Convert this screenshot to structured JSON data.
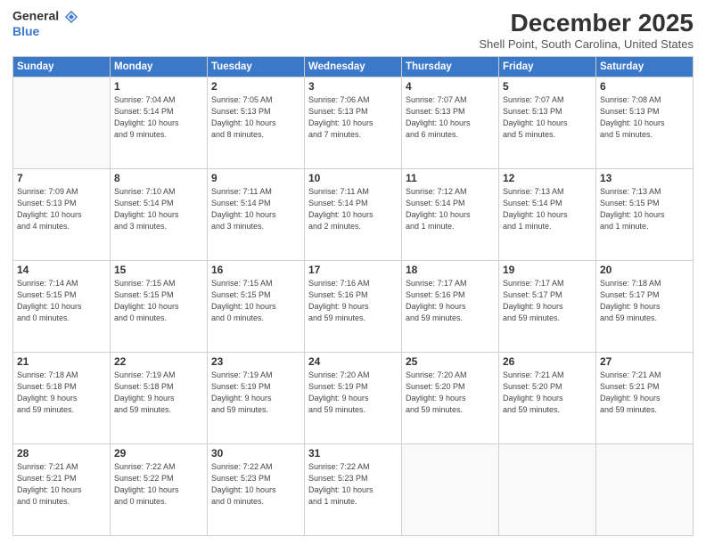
{
  "header": {
    "logo_line1": "General",
    "logo_line2": "Blue",
    "month": "December 2025",
    "location": "Shell Point, South Carolina, United States"
  },
  "weekdays": [
    "Sunday",
    "Monday",
    "Tuesday",
    "Wednesday",
    "Thursday",
    "Friday",
    "Saturday"
  ],
  "weeks": [
    [
      {
        "day": "",
        "info": ""
      },
      {
        "day": "1",
        "info": "Sunrise: 7:04 AM\nSunset: 5:14 PM\nDaylight: 10 hours\nand 9 minutes."
      },
      {
        "day": "2",
        "info": "Sunrise: 7:05 AM\nSunset: 5:13 PM\nDaylight: 10 hours\nand 8 minutes."
      },
      {
        "day": "3",
        "info": "Sunrise: 7:06 AM\nSunset: 5:13 PM\nDaylight: 10 hours\nand 7 minutes."
      },
      {
        "day": "4",
        "info": "Sunrise: 7:07 AM\nSunset: 5:13 PM\nDaylight: 10 hours\nand 6 minutes."
      },
      {
        "day": "5",
        "info": "Sunrise: 7:07 AM\nSunset: 5:13 PM\nDaylight: 10 hours\nand 5 minutes."
      },
      {
        "day": "6",
        "info": "Sunrise: 7:08 AM\nSunset: 5:13 PM\nDaylight: 10 hours\nand 5 minutes."
      }
    ],
    [
      {
        "day": "7",
        "info": "Sunrise: 7:09 AM\nSunset: 5:13 PM\nDaylight: 10 hours\nand 4 minutes."
      },
      {
        "day": "8",
        "info": "Sunrise: 7:10 AM\nSunset: 5:14 PM\nDaylight: 10 hours\nand 3 minutes."
      },
      {
        "day": "9",
        "info": "Sunrise: 7:11 AM\nSunset: 5:14 PM\nDaylight: 10 hours\nand 3 minutes."
      },
      {
        "day": "10",
        "info": "Sunrise: 7:11 AM\nSunset: 5:14 PM\nDaylight: 10 hours\nand 2 minutes."
      },
      {
        "day": "11",
        "info": "Sunrise: 7:12 AM\nSunset: 5:14 PM\nDaylight: 10 hours\nand 1 minute."
      },
      {
        "day": "12",
        "info": "Sunrise: 7:13 AM\nSunset: 5:14 PM\nDaylight: 10 hours\nand 1 minute."
      },
      {
        "day": "13",
        "info": "Sunrise: 7:13 AM\nSunset: 5:15 PM\nDaylight: 10 hours\nand 1 minute."
      }
    ],
    [
      {
        "day": "14",
        "info": "Sunrise: 7:14 AM\nSunset: 5:15 PM\nDaylight: 10 hours\nand 0 minutes."
      },
      {
        "day": "15",
        "info": "Sunrise: 7:15 AM\nSunset: 5:15 PM\nDaylight: 10 hours\nand 0 minutes."
      },
      {
        "day": "16",
        "info": "Sunrise: 7:15 AM\nSunset: 5:15 PM\nDaylight: 10 hours\nand 0 minutes."
      },
      {
        "day": "17",
        "info": "Sunrise: 7:16 AM\nSunset: 5:16 PM\nDaylight: 9 hours\nand 59 minutes."
      },
      {
        "day": "18",
        "info": "Sunrise: 7:17 AM\nSunset: 5:16 PM\nDaylight: 9 hours\nand 59 minutes."
      },
      {
        "day": "19",
        "info": "Sunrise: 7:17 AM\nSunset: 5:17 PM\nDaylight: 9 hours\nand 59 minutes."
      },
      {
        "day": "20",
        "info": "Sunrise: 7:18 AM\nSunset: 5:17 PM\nDaylight: 9 hours\nand 59 minutes."
      }
    ],
    [
      {
        "day": "21",
        "info": "Sunrise: 7:18 AM\nSunset: 5:18 PM\nDaylight: 9 hours\nand 59 minutes."
      },
      {
        "day": "22",
        "info": "Sunrise: 7:19 AM\nSunset: 5:18 PM\nDaylight: 9 hours\nand 59 minutes."
      },
      {
        "day": "23",
        "info": "Sunrise: 7:19 AM\nSunset: 5:19 PM\nDaylight: 9 hours\nand 59 minutes."
      },
      {
        "day": "24",
        "info": "Sunrise: 7:20 AM\nSunset: 5:19 PM\nDaylight: 9 hours\nand 59 minutes."
      },
      {
        "day": "25",
        "info": "Sunrise: 7:20 AM\nSunset: 5:20 PM\nDaylight: 9 hours\nand 59 minutes."
      },
      {
        "day": "26",
        "info": "Sunrise: 7:21 AM\nSunset: 5:20 PM\nDaylight: 9 hours\nand 59 minutes."
      },
      {
        "day": "27",
        "info": "Sunrise: 7:21 AM\nSunset: 5:21 PM\nDaylight: 9 hours\nand 59 minutes."
      }
    ],
    [
      {
        "day": "28",
        "info": "Sunrise: 7:21 AM\nSunset: 5:21 PM\nDaylight: 10 hours\nand 0 minutes."
      },
      {
        "day": "29",
        "info": "Sunrise: 7:22 AM\nSunset: 5:22 PM\nDaylight: 10 hours\nand 0 minutes."
      },
      {
        "day": "30",
        "info": "Sunrise: 7:22 AM\nSunset: 5:23 PM\nDaylight: 10 hours\nand 0 minutes."
      },
      {
        "day": "31",
        "info": "Sunrise: 7:22 AM\nSunset: 5:23 PM\nDaylight: 10 hours\nand 1 minute."
      },
      {
        "day": "",
        "info": ""
      },
      {
        "day": "",
        "info": ""
      },
      {
        "day": "",
        "info": ""
      }
    ]
  ]
}
